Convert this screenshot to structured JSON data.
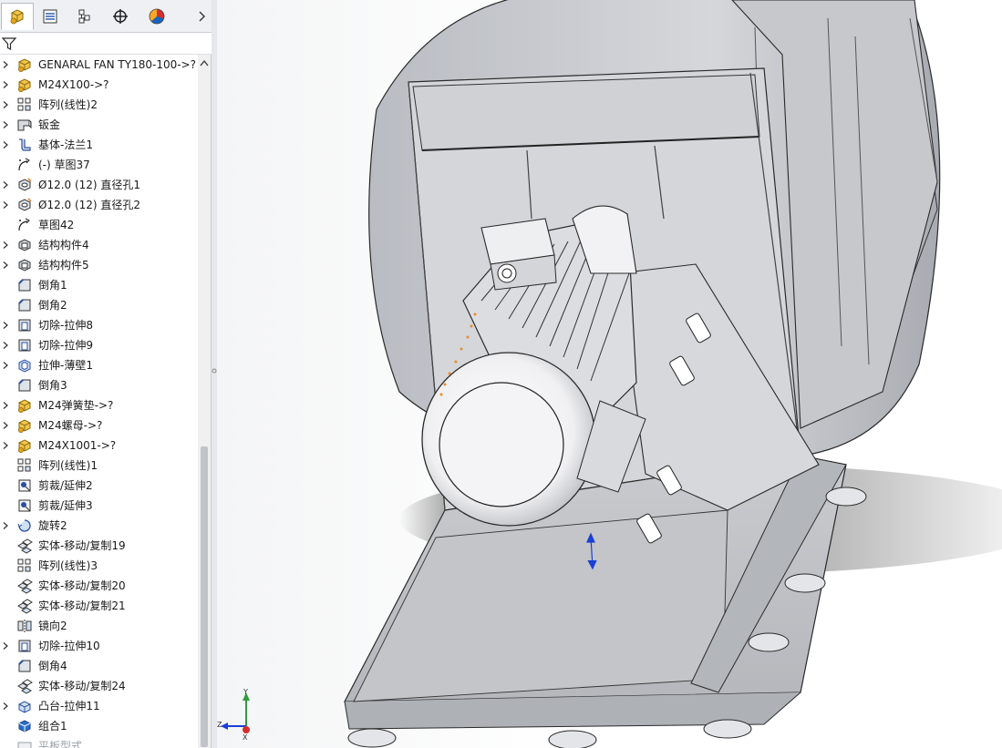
{
  "window": {
    "tabs": [
      {
        "name": "featuremanager",
        "icon": "assembly-icon"
      },
      {
        "name": "propertymanager",
        "icon": "property-list-icon"
      },
      {
        "name": "configurationmanager",
        "icon": "configuration-icon"
      },
      {
        "name": "dimxpert",
        "icon": "crosshair-icon"
      },
      {
        "name": "display-manager",
        "icon": "color-wheel-icon"
      }
    ],
    "filter_icon": "filter-funnel-icon"
  },
  "tree": {
    "items": [
      {
        "label": "GENARAL FAN TY180-100->?",
        "icon": "part-icon",
        "expandable": true
      },
      {
        "label": "M24X100->?",
        "icon": "part-icon",
        "expandable": true
      },
      {
        "label": "阵列(线性)2",
        "icon": "linear-pattern-icon",
        "expandable": true
      },
      {
        "label": "钣金",
        "icon": "sheet-metal-icon",
        "expandable": true
      },
      {
        "label": "基体-法兰1",
        "icon": "base-flange-icon",
        "expandable": true
      },
      {
        "label": "(-) 草图37",
        "icon": "sketch-icon",
        "expandable": false
      },
      {
        "label": "Ø12.0 (12) 直径孔1",
        "icon": "hole-icon",
        "expandable": true
      },
      {
        "label": "Ø12.0 (12) 直径孔2",
        "icon": "hole-icon",
        "expandable": true
      },
      {
        "label": "草图42",
        "icon": "sketch-icon",
        "expandable": false
      },
      {
        "label": "结构构件4",
        "icon": "structural-member-icon",
        "expandable": true
      },
      {
        "label": "结构构件5",
        "icon": "structural-member-icon",
        "expandable": true
      },
      {
        "label": "倒角1",
        "icon": "chamfer-icon",
        "expandable": false
      },
      {
        "label": "倒角2",
        "icon": "chamfer-icon",
        "expandable": false
      },
      {
        "label": "切除-拉伸8",
        "icon": "extruded-cut-icon",
        "expandable": true
      },
      {
        "label": "切除-拉伸9",
        "icon": "extruded-cut-icon",
        "expandable": true
      },
      {
        "label": "拉伸-薄壁1",
        "icon": "thin-extrude-icon",
        "expandable": true
      },
      {
        "label": "倒角3",
        "icon": "chamfer-icon",
        "expandable": false
      },
      {
        "label": "M24弹簧垫->?",
        "icon": "part-icon",
        "expandable": true
      },
      {
        "label": "M24螺母->?",
        "icon": "part-icon",
        "expandable": true
      },
      {
        "label": "M24X1001->?",
        "icon": "part-icon",
        "expandable": true
      },
      {
        "label": "阵列(线性)1",
        "icon": "linear-pattern-icon",
        "expandable": false
      },
      {
        "label": "剪裁/延伸2",
        "icon": "trim-extend-icon",
        "expandable": false
      },
      {
        "label": "剪裁/延伸3",
        "icon": "trim-extend-icon",
        "expandable": false
      },
      {
        "label": "旋转2",
        "icon": "revolve-icon",
        "expandable": true
      },
      {
        "label": "实体-移动/复制19",
        "icon": "move-copy-body-icon",
        "expandable": false
      },
      {
        "label": "阵列(线性)3",
        "icon": "linear-pattern-icon",
        "expandable": false
      },
      {
        "label": "实体-移动/复制20",
        "icon": "move-copy-body-icon",
        "expandable": false
      },
      {
        "label": "实体-移动/复制21",
        "icon": "move-copy-body-icon",
        "expandable": false
      },
      {
        "label": "镜向2",
        "icon": "mirror-icon",
        "expandable": false
      },
      {
        "label": "切除-拉伸10",
        "icon": "extruded-cut-icon",
        "expandable": true
      },
      {
        "label": "倒角4",
        "icon": "chamfer-icon",
        "expandable": false
      },
      {
        "label": "实体-移动/复制24",
        "icon": "move-copy-body-icon",
        "expandable": false
      },
      {
        "label": "凸台-拉伸11",
        "icon": "boss-extrude-icon",
        "expandable": true
      },
      {
        "label": "组合1",
        "icon": "combine-icon",
        "expandable": false
      },
      {
        "label": "平板型式",
        "icon": "flat-pattern-icon",
        "expandable": false,
        "dim": true
      }
    ]
  },
  "viewport": {
    "triad": {
      "x_label": "Z",
      "y_label": "Y",
      "z_label": "X"
    }
  }
}
